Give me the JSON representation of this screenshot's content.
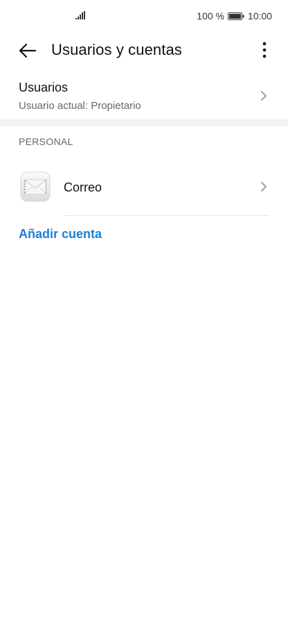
{
  "status_bar": {
    "battery_text": "100 %",
    "time": "10:00",
    "icons": [
      "signal-icon",
      "battery-icon"
    ]
  },
  "app_bar": {
    "title": "Usuarios y cuentas",
    "icons": [
      "back-arrow-icon",
      "more-vertical-icon"
    ]
  },
  "users": {
    "title": "Usuarios",
    "subtitle": "Usuario actual: Propietario"
  },
  "personal_section": {
    "header": "PERSONAL",
    "items": [
      {
        "label": "Correo",
        "icon": "mail-icon"
      }
    ]
  },
  "add_account_label": "Añadir cuenta",
  "colors": {
    "accent": "#1a7fd6",
    "divider": "#f1f3f5",
    "secondary_text": "#666666"
  }
}
